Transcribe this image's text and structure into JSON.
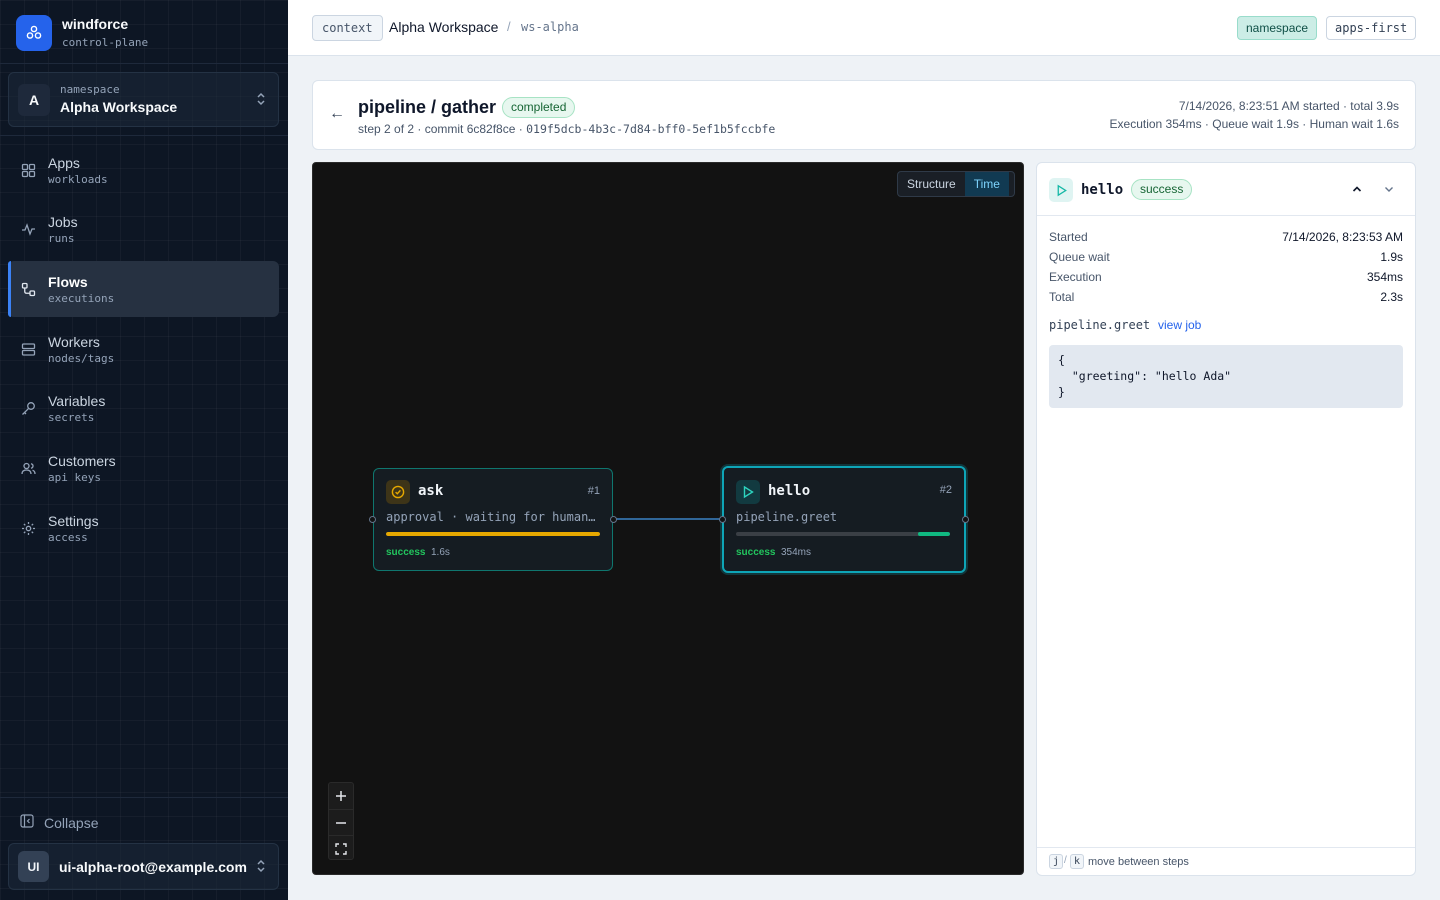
{
  "app": {
    "name": "windforce",
    "subtitle": "control-plane"
  },
  "namespace": {
    "label": "namespace",
    "initial": "A",
    "name": "Alpha Workspace"
  },
  "nav": [
    {
      "label": "Apps",
      "sub": "workloads",
      "icon": "grid-icon",
      "active": false
    },
    {
      "label": "Jobs",
      "sub": "runs",
      "icon": "activity-icon",
      "active": false
    },
    {
      "label": "Flows",
      "sub": "executions",
      "icon": "flow-icon",
      "active": true
    },
    {
      "label": "Workers",
      "sub": "nodes/tags",
      "icon": "server-icon",
      "active": false
    },
    {
      "label": "Variables",
      "sub": "secrets",
      "icon": "key-icon",
      "active": false
    },
    {
      "label": "Customers",
      "sub": "api keys",
      "icon": "users-icon",
      "active": false
    },
    {
      "label": "Settings",
      "sub": "access",
      "icon": "gear-icon",
      "active": false
    }
  ],
  "sidebar_footer": {
    "collapse_label": "Collapse",
    "user_initials": "UI",
    "user_email": "ui-alpha-root@example.com"
  },
  "header": {
    "context_tag": "context",
    "workspace": "Alpha Workspace",
    "separator": "/",
    "workspace_id": "ws-alpha",
    "namespace_pill": "namespace",
    "mode_pill": "apps-first"
  },
  "run": {
    "back_glyph": "←",
    "title": "pipeline / gather",
    "status": "completed",
    "step_info": "step 2 of 2 · commit 6c82f8ce ·",
    "run_id": "019f5dcb-4b3c-7d84-bff0-5ef1b5fccbfe",
    "timing_line1": "7/14/2026, 8:23:51 AM started · total 3.9s",
    "timing_line2": "Execution 354ms · Queue wait 1.9s · Human wait 1.6s"
  },
  "graph": {
    "view_toggle": [
      "Structure",
      "Time"
    ],
    "active_view": "Time",
    "nodes": [
      {
        "name": "ask",
        "number": "#1",
        "detail": "approval · waiting for human approval",
        "status": "success",
        "duration": "1.6s",
        "icon": "approval-check-icon",
        "progress_start": 0,
        "progress_end": 1,
        "bar_color": "#e6a800"
      },
      {
        "name": "hello",
        "number": "#2",
        "detail": "pipeline.greet",
        "status": "success",
        "duration": "354ms",
        "icon": "play-icon",
        "progress_start": 0.85,
        "progress_end": 1,
        "bar_color": "#10b981"
      }
    ],
    "zoom_controls": [
      "+",
      "—",
      "⛶"
    ]
  },
  "step": {
    "name": "hello",
    "status": "success",
    "rows": [
      {
        "key": "Started",
        "value": "7/14/2026, 8:23:53 AM"
      },
      {
        "key": "Queue wait",
        "value": "1.9s"
      },
      {
        "key": "Execution",
        "value": "354ms"
      },
      {
        "key": "Total",
        "value": "2.3s"
      }
    ],
    "job_ref": "pipeline.greet",
    "job_link": "view job",
    "output_json": "{\n  \"greeting\": \"hello Ada\"\n}",
    "kbd_next": "j",
    "kbd_sep": "/",
    "kbd_prev": "k",
    "hint": "move between steps"
  },
  "colors": {
    "accent": "#2563eb",
    "teal": "#0ea5b7",
    "success": "#22c55e",
    "approval": "#e6a800"
  }
}
